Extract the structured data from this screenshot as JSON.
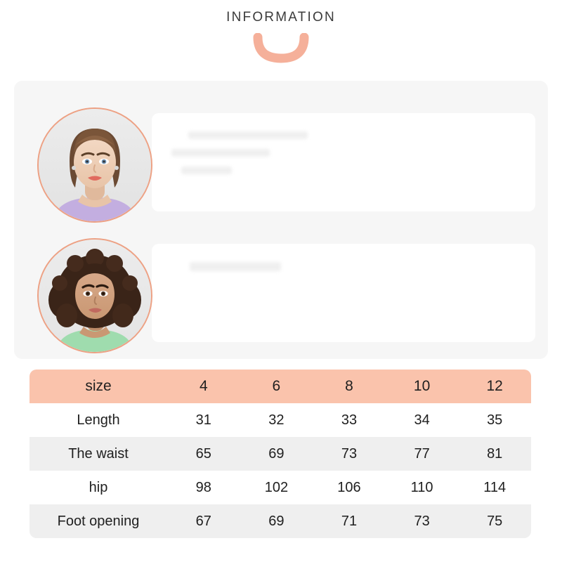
{
  "header": {
    "title": "INFORMATION",
    "decoration_icon": "smile-arc-icon",
    "accent_color": "#f5b09a"
  },
  "theme": {
    "panel_background": "#f6f6f6",
    "card_background": "#ffffff",
    "table_header_background": "#fac3ac",
    "table_row_alt_background": "#efefef",
    "avatar_ring_color": "#eda184",
    "text_color": "#1f1f1f"
  },
  "profiles": [
    {
      "avatar_icon": "model-portrait-straight-hair-icon",
      "avatar_alt": "Model with brown updo hair wearing a lavender top",
      "description_lines": [
        "",
        "",
        ""
      ]
    },
    {
      "avatar_icon": "model-portrait-curly-hair-icon",
      "avatar_alt": "Model with dark curly hair wearing a mint green top",
      "description_lines": [
        ""
      ]
    }
  ],
  "size_table": {
    "columns": [
      "size",
      "4",
      "6",
      "8",
      "10",
      "12"
    ],
    "rows": [
      {
        "label": "Length",
        "values": [
          "31",
          "32",
          "33",
          "34",
          "35"
        ]
      },
      {
        "label": "The waist",
        "values": [
          "65",
          "69",
          "73",
          "77",
          "81"
        ]
      },
      {
        "label": "hip",
        "values": [
          "98",
          "102",
          "106",
          "110",
          "114"
        ]
      },
      {
        "label": "Foot opening",
        "values": [
          "67",
          "69",
          "71",
          "73",
          "75"
        ]
      }
    ]
  }
}
